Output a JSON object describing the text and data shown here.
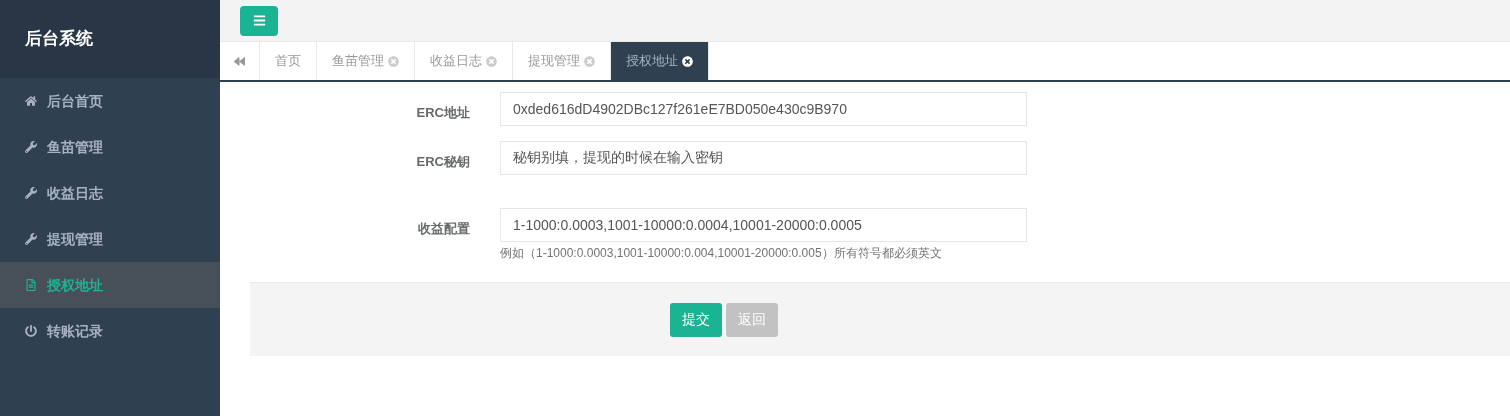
{
  "sidebar": {
    "title": "后台系统",
    "items": [
      {
        "label": "后台首页",
        "selected": false
      },
      {
        "label": "鱼苗管理",
        "selected": false
      },
      {
        "label": "收益日志",
        "selected": false
      },
      {
        "label": "提现管理",
        "selected": false
      },
      {
        "label": "授权地址",
        "selected": true
      },
      {
        "label": "转账记录",
        "selected": false
      }
    ]
  },
  "tabs": [
    {
      "label": "首页",
      "selected": false,
      "closable": false
    },
    {
      "label": "鱼苗管理",
      "selected": false,
      "closable": true
    },
    {
      "label": "收益日志",
      "selected": false,
      "closable": true
    },
    {
      "label": "提现管理",
      "selected": false,
      "closable": true
    },
    {
      "label": "授权地址",
      "selected": true,
      "closable": true
    }
  ],
  "form": {
    "fields": [
      {
        "label": "ERC地址",
        "value": "0xded616dD4902DBc127f261eE7BD050e430c9B970"
      },
      {
        "label": "ERC秘钥",
        "value": "秘钥别填，提现的时候在输入密钥"
      },
      {
        "label": "收益配置",
        "value": "1-1000:0.0003,1001-10000:0.0004,10001-20000:0.0005",
        "help": "例如（1-1000:0.0003,1001-10000:0.004,10001-20000:0.005）所有符号都必须英文"
      }
    ],
    "buttons": [
      {
        "label": "提交",
        "kind": "primary"
      },
      {
        "label": "返回",
        "kind": "default"
      }
    ]
  }
}
